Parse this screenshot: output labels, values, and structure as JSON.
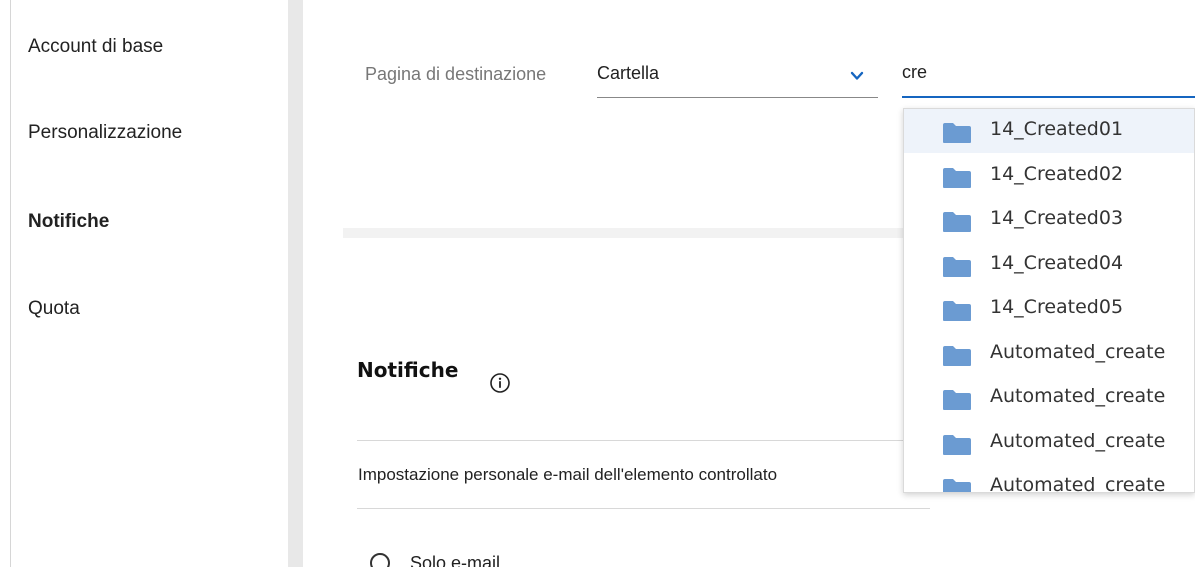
{
  "sidebar": {
    "items": [
      {
        "label": "Account di base",
        "active": false
      },
      {
        "label": "Personalizzazione",
        "active": false
      },
      {
        "label": "Notifiche",
        "active": true
      },
      {
        "label": "Quota",
        "active": false
      }
    ]
  },
  "landing": {
    "label": "Pagina di destinazione",
    "selected": "Cartella",
    "search_value": "cre"
  },
  "dropdown": {
    "items": [
      "14_Created01",
      "14_Created02",
      "14_Created03",
      "14_Created04",
      "14_Created05",
      "Automated_create",
      "Automated_create",
      "Automated_create",
      "Automated_create"
    ]
  },
  "notifications": {
    "title": "Notifiche",
    "setting_label": "Impostazione personale e-mail dell'elemento controllato",
    "radio_label": "Solo e-mail"
  },
  "colors": {
    "accent": "#1565c0",
    "folder": "#6b9bd2",
    "divider": "#e8e8e8"
  }
}
